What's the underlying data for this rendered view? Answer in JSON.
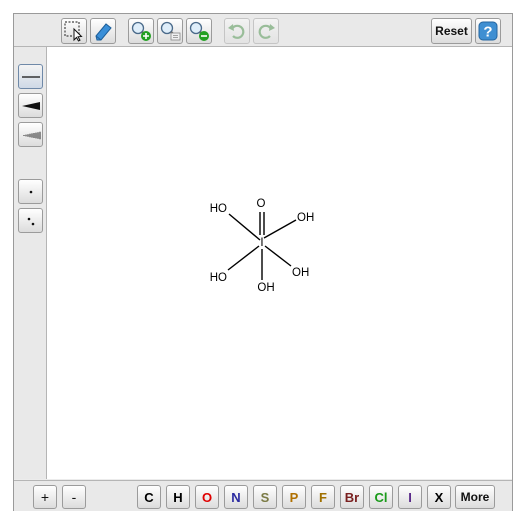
{
  "toolbar_top": {
    "tools": [
      {
        "icon": "select-icon",
        "state": "normal"
      },
      {
        "icon": "eraser-icon",
        "state": "normal"
      },
      {
        "icon": "zoom-in-icon",
        "state": "normal"
      },
      {
        "icon": "zoom-reset-icon",
        "state": "normal"
      },
      {
        "icon": "zoom-out-icon",
        "state": "normal"
      },
      {
        "icon": "undo-icon",
        "state": "disabled"
      },
      {
        "icon": "redo-icon",
        "state": "disabled"
      }
    ],
    "reset_label": "Reset",
    "help_icon": "help-icon"
  },
  "toolbar_left": {
    "bond_tools": [
      "single-bond-icon",
      "wedge-bond-icon",
      "hash-bond-icon"
    ],
    "selected": "single-bond-icon",
    "radical_tools": [
      "radical-single-icon",
      "radical-double-icon"
    ]
  },
  "toolbar_bottom": {
    "charge_plus": "+",
    "charge_minus": "-",
    "elements": [
      {
        "label": "C",
        "color": "#000000"
      },
      {
        "label": "H",
        "color": "#000000"
      },
      {
        "label": "O",
        "color": "#e00000"
      },
      {
        "label": "N",
        "color": "#2a2aa0"
      },
      {
        "label": "S",
        "color": "#7a7a44"
      },
      {
        "label": "P",
        "color": "#b07000"
      },
      {
        "label": "F",
        "color": "#a07000"
      },
      {
        "label": "Br",
        "color": "#7a2020"
      },
      {
        "label": "Cl",
        "color": "#1a9a1a"
      },
      {
        "label": "I",
        "color": "#5a2a8a"
      },
      {
        "label": "X",
        "color": "#000000"
      }
    ],
    "more_label": "More"
  },
  "molecule": {
    "center_atom": "I",
    "substituents": [
      "O",
      "OH",
      "OH",
      "OH",
      "HO",
      "HO"
    ]
  }
}
